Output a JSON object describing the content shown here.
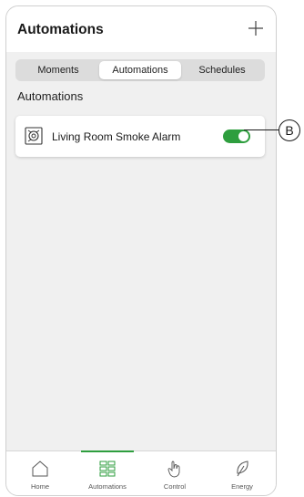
{
  "header": {
    "title": "Automations",
    "add_icon": "plus-icon"
  },
  "segments": [
    {
      "label": "Moments",
      "active": false
    },
    {
      "label": "Automations",
      "active": true
    },
    {
      "label": "Schedules",
      "active": false
    }
  ],
  "section": {
    "title": "Automations"
  },
  "automations": [
    {
      "label": "Living Room Smoke Alarm",
      "icon": "smoke-alarm-icon",
      "enabled": true
    }
  ],
  "callout": {
    "label": "B"
  },
  "tabbar": [
    {
      "label": "Home",
      "icon": "home-icon",
      "active": false
    },
    {
      "label": "Automations",
      "icon": "grid-icon",
      "active": true
    },
    {
      "label": "Control",
      "icon": "hand-icon",
      "active": false
    },
    {
      "label": "Energy",
      "icon": "leaf-icon",
      "active": false
    }
  ],
  "colors": {
    "accent": "#2e9e3e",
    "background": "#f0f0f0"
  }
}
